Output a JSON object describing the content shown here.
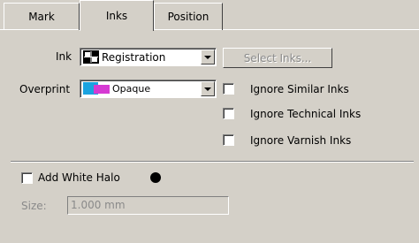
{
  "tabs": [
    {
      "label": "Mark"
    },
    {
      "label": "Inks"
    },
    {
      "label": "Position"
    }
  ],
  "ink": {
    "label": "Ink",
    "value": "Registration",
    "icon": "registration-mark-icon",
    "select_inks_label": "Select Inks..."
  },
  "overprint": {
    "label": "Overprint",
    "value": "Opaque",
    "icon": "opaque-swatch-icon"
  },
  "checkboxes": [
    {
      "label": "Ignore Similar Inks",
      "checked": false
    },
    {
      "label": "Ignore Technical Inks",
      "checked": false
    },
    {
      "label": "Ignore Varnish Inks",
      "checked": false
    }
  ],
  "halo": {
    "label": "Add White Halo",
    "checked": false,
    "size_label": "Size:",
    "size_value": "1.000 mm"
  },
  "colors": {
    "face": "#d4d0c8",
    "disabled_text": "#8a8a8a",
    "swatch_cyan": "#1aa3e0",
    "swatch_magenta": "#d63ad3"
  }
}
